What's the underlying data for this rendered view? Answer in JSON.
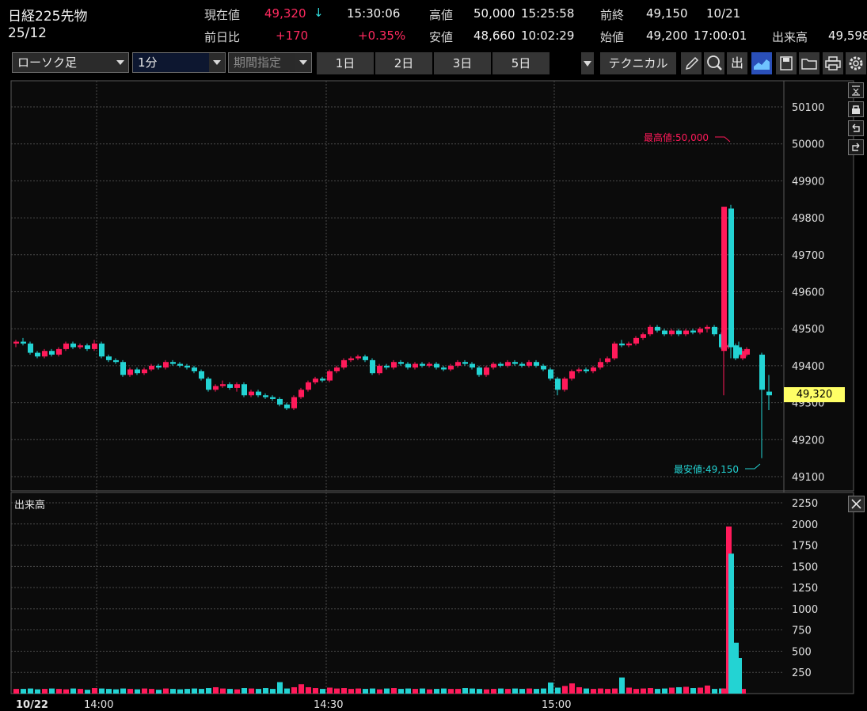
{
  "symbol": {
    "name": "日経225先物",
    "contract": "25/12"
  },
  "quote": {
    "current_label": "現在値",
    "current_value": "49,320",
    "current_arrow": "↓",
    "current_time": "15:30:06",
    "high_label": "高値",
    "high_value": "50,000",
    "high_time": "15:25:58",
    "prev_close_label": "前終",
    "prev_close_value": "49,150",
    "prev_close_date": "10/21",
    "change_label": "前日比",
    "change_value": "+170",
    "change_pct": "+0.35%",
    "low_label": "安値",
    "low_value": "48,660",
    "low_time": "10:02:29",
    "open_label": "始値",
    "open_value": "49,200",
    "open_time": "17:00:01",
    "volume_label": "出来高",
    "volume_value": "49,598"
  },
  "toolbar": {
    "chart_type": "ローソク足",
    "interval": "1分",
    "period_placeholder": "期間指定",
    "ranges": [
      "1日",
      "2日",
      "3日",
      "5日"
    ],
    "technical_label": "テクニカル",
    "icons": [
      "pencil-icon",
      "zoom-icon",
      "output-icon",
      "area-chart-icon",
      "save-icon",
      "folder-icon",
      "print-icon",
      "settings-icon"
    ],
    "output_label": "出"
  },
  "side_tools": [
    "collapse-icon",
    "lock-icon",
    "undo-icon",
    "redo-icon"
  ],
  "colors": {
    "up": "#ff1a5a",
    "down": "#23d3d3",
    "grid": "#4a4a4a",
    "price_tag": "#ffff66"
  },
  "chart_data": [
    {
      "type": "candlestick",
      "title": "",
      "ylim": [
        49050,
        50150
      ],
      "yticks": [
        50100,
        50000,
        49900,
        49800,
        49700,
        49600,
        49500,
        49400,
        49300,
        49200,
        49100
      ],
      "last_price_label": "49,320",
      "last_price": 49320,
      "high_annotation": "最高値:50,000",
      "low_annotation": "最安値:49,150",
      "x_labels": [
        "10/22",
        "14:00",
        "14:30",
        "15:00"
      ],
      "candles": [
        [
          49460,
          49470,
          49450,
          49465
        ],
        [
          49465,
          49475,
          49455,
          49460
        ],
        [
          49460,
          49465,
          49430,
          49435
        ],
        [
          49435,
          49440,
          49420,
          49425
        ],
        [
          49425,
          49445,
          49420,
          49440
        ],
        [
          49440,
          49445,
          49425,
          49430
        ],
        [
          49430,
          49450,
          49425,
          49445
        ],
        [
          49445,
          49465,
          49440,
          49460
        ],
        [
          49460,
          49465,
          49445,
          49450
        ],
        [
          49450,
          49460,
          49445,
          49455
        ],
        [
          49455,
          49460,
          49440,
          49445
        ],
        [
          49445,
          49470,
          49440,
          49460
        ],
        [
          49460,
          49465,
          49420,
          49425
        ],
        [
          49425,
          49430,
          49410,
          49415
        ],
        [
          49415,
          49420,
          49405,
          49410
        ],
        [
          49410,
          49415,
          49370,
          49375
        ],
        [
          49375,
          49395,
          49370,
          49390
        ],
        [
          49390,
          49395,
          49375,
          49380
        ],
        [
          49380,
          49395,
          49375,
          49390
        ],
        [
          49390,
          49405,
          49385,
          49400
        ],
        [
          49400,
          49405,
          49390,
          49395
        ],
        [
          49395,
          49415,
          49390,
          49410
        ],
        [
          49410,
          49415,
          49400,
          49405
        ],
        [
          49405,
          49410,
          49395,
          49400
        ],
        [
          49400,
          49405,
          49390,
          49395
        ],
        [
          49395,
          49400,
          49380,
          49385
        ],
        [
          49385,
          49390,
          49360,
          49365
        ],
        [
          49365,
          49370,
          49330,
          49335
        ],
        [
          49335,
          49350,
          49330,
          49345
        ],
        [
          49345,
          49360,
          49340,
          49350
        ],
        [
          49350,
          49355,
          49335,
          49340
        ],
        [
          49340,
          49355,
          49330,
          49350
        ],
        [
          49350,
          49355,
          49315,
          49320
        ],
        [
          49320,
          49335,
          49315,
          49330
        ],
        [
          49330,
          49335,
          49315,
          49320
        ],
        [
          49320,
          49325,
          49310,
          49315
        ],
        [
          49315,
          49320,
          49305,
          49310
        ],
        [
          49310,
          49315,
          49290,
          49295
        ],
        [
          49295,
          49300,
          49280,
          49285
        ],
        [
          49285,
          49320,
          49280,
          49315
        ],
        [
          49315,
          49340,
          49310,
          49335
        ],
        [
          49335,
          49360,
          49330,
          49355
        ],
        [
          49355,
          49370,
          49350,
          49365
        ],
        [
          49365,
          49370,
          49355,
          49360
        ],
        [
          49360,
          49390,
          49355,
          49385
        ],
        [
          49385,
          49400,
          49380,
          49395
        ],
        [
          49395,
          49420,
          49390,
          49415
        ],
        [
          49415,
          49425,
          49410,
          49420
        ],
        [
          49420,
          49430,
          49415,
          49425
        ],
        [
          49425,
          49430,
          49410,
          49415
        ],
        [
          49415,
          49420,
          49375,
          49380
        ],
        [
          49380,
          49405,
          49375,
          49400
        ],
        [
          49400,
          49405,
          49390,
          49395
        ],
        [
          49395,
          49415,
          49390,
          49410
        ],
        [
          49410,
          49415,
          49400,
          49405
        ],
        [
          49405,
          49410,
          49390,
          49395
        ],
        [
          49395,
          49410,
          49390,
          49405
        ],
        [
          49405,
          49410,
          49395,
          49400
        ],
        [
          49400,
          49410,
          49395,
          49405
        ],
        [
          49405,
          49410,
          49390,
          49395
        ],
        [
          49395,
          49400,
          49385,
          49390
        ],
        [
          49390,
          49405,
          49385,
          49400
        ],
        [
          49400,
          49415,
          49395,
          49410
        ],
        [
          49410,
          49415,
          49400,
          49405
        ],
        [
          49405,
          49410,
          49390,
          49395
        ],
        [
          49395,
          49400,
          49370,
          49375
        ],
        [
          49375,
          49400,
          49370,
          49395
        ],
        [
          49395,
          49410,
          49390,
          49405
        ],
        [
          49405,
          49410,
          49395,
          49400
        ],
        [
          49400,
          49415,
          49395,
          49410
        ],
        [
          49410,
          49415,
          49400,
          49405
        ],
        [
          49405,
          49410,
          49395,
          49400
        ],
        [
          49400,
          49415,
          49395,
          49410
        ],
        [
          49410,
          49415,
          49395,
          49400
        ],
        [
          49400,
          49405,
          49385,
          49390
        ],
        [
          49390,
          49395,
          49360,
          49365
        ],
        [
          49365,
          49370,
          49320,
          49335
        ],
        [
          49335,
          49370,
          49330,
          49365
        ],
        [
          49365,
          49390,
          49360,
          49385
        ],
        [
          49385,
          49395,
          49380,
          49390
        ],
        [
          49390,
          49395,
          49380,
          49385
        ],
        [
          49385,
          49400,
          49380,
          49395
        ],
        [
          49395,
          49420,
          49390,
          49410
        ],
        [
          49410,
          49425,
          49405,
          49420
        ],
        [
          49420,
          49465,
          49415,
          49460
        ],
        [
          49460,
          49470,
          49450,
          49455
        ],
        [
          49455,
          49465,
          49450,
          49460
        ],
        [
          49460,
          49480,
          49455,
          49475
        ],
        [
          49475,
          49490,
          49470,
          49485
        ],
        [
          49485,
          49510,
          49480,
          49505
        ],
        [
          49505,
          49510,
          49490,
          49495
        ],
        [
          49495,
          49500,
          49480,
          49485
        ],
        [
          49485,
          49500,
          49480,
          49495
        ],
        [
          49495,
          49500,
          49480,
          49485
        ],
        [
          49485,
          49500,
          49480,
          49495
        ],
        [
          49495,
          49500,
          49485,
          49490
        ],
        [
          49490,
          49505,
          49485,
          49500
        ],
        [
          49500,
          49510,
          49490,
          49505
        ],
        [
          49505,
          49510,
          49480,
          49485
        ],
        [
          49485,
          49490,
          49445,
          49450
        ],
        [
          49450,
          49460,
          49445,
          49455
        ],
        [
          49455,
          49460,
          49415,
          49420
        ],
        [
          49420,
          49445,
          49415,
          49440
        ],
        [
          49440,
          49830,
          49320,
          49830
        ],
        [
          49825,
          49835,
          49420,
          49450
        ],
        [
          49450,
          49465,
          49425,
          49430
        ],
        [
          49430,
          49450,
          49425,
          49445
        ],
        [
          49430,
          49435,
          49150,
          49335
        ],
        [
          49330,
          49375,
          49280,
          49320
        ]
      ]
    },
    {
      "type": "bar",
      "title": "出来高",
      "ylim": [
        0,
        2300
      ],
      "yticks": [
        2250,
        2000,
        1750,
        1500,
        1250,
        1000,
        750,
        500,
        250
      ],
      "values": [
        55,
        55,
        60,
        50,
        55,
        60,
        55,
        50,
        60,
        55,
        45,
        65,
        60,
        55,
        50,
        60,
        55,
        50,
        60,
        55,
        45,
        60,
        55,
        50,
        55,
        60,
        55,
        65,
        75,
        60,
        55,
        50,
        65,
        60,
        55,
        65,
        55,
        135,
        60,
        75,
        110,
        75,
        65,
        55,
        70,
        60,
        65,
        55,
        60,
        55,
        60,
        50,
        60,
        65,
        55,
        60,
        55,
        60,
        50,
        55,
        60,
        55,
        55,
        65,
        60,
        55,
        50,
        55,
        60,
        55,
        60,
        55,
        60,
        55,
        60,
        130,
        70,
        90,
        120,
        75,
        60,
        55,
        60,
        55,
        60,
        190,
        70,
        55,
        60,
        65,
        55,
        60,
        70,
        75,
        80,
        65,
        70,
        95,
        55,
        60,
        1970,
        600,
        55,
        60,
        1650,
        420
      ],
      "last_price": 49320
    }
  ]
}
